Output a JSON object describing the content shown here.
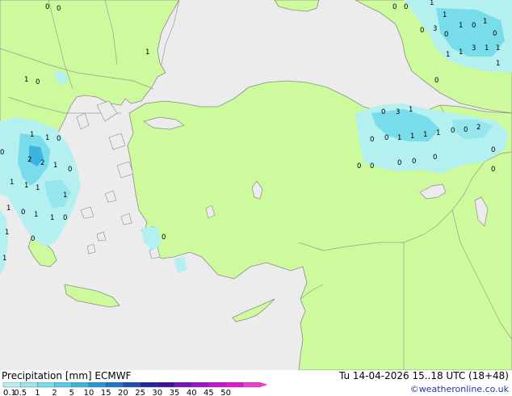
{
  "title": {
    "left": "Precipitation [mm]  ECMWF",
    "right": "Tu 14-04-2026 15..18 UTC (18+48)"
  },
  "credit": "©weatheronline.co.uk",
  "colors": {
    "sea": "#ececec",
    "land": "#ccfa9c",
    "border": "#9a9a9a"
  },
  "legend": {
    "ticks": [
      "0.1",
      "0.5",
      "1",
      "2",
      "5",
      "10",
      "15",
      "20",
      "25",
      "30",
      "35",
      "40",
      "45",
      "50"
    ],
    "colors": [
      "#b4f0f0",
      "#96e6ee",
      "#78dcea",
      "#5ac8e6",
      "#3cb4e0",
      "#2896d6",
      "#1e78c8",
      "#1e50b4",
      "#1e28a0",
      "#3c1496",
      "#7814b4",
      "#a014c8",
      "#c814d2",
      "#e614c8",
      "#f03cd2"
    ]
  },
  "precip_labels": [
    {
      "name": "label-nw-1",
      "text": "0"
    },
    {
      "name": "label-nw-2",
      "text": "0"
    },
    {
      "name": "label-nw-3",
      "text": "1"
    },
    {
      "name": "label-bal-1",
      "text": "1"
    },
    {
      "name": "label-bal-2",
      "text": "0"
    },
    {
      "name": "label-gr-1",
      "text": "1"
    },
    {
      "name": "label-gr-2",
      "text": "1"
    },
    {
      "name": "label-gr-3",
      "text": "0"
    },
    {
      "name": "label-gr-4",
      "text": "2"
    },
    {
      "name": "label-gr-5",
      "text": "2"
    },
    {
      "name": "label-gr-6",
      "text": "1"
    },
    {
      "name": "label-gr-7",
      "text": "0"
    },
    {
      "name": "label-gr-8",
      "text": "1"
    },
    {
      "name": "label-gr-9",
      "text": "1"
    },
    {
      "name": "label-gr-10",
      "text": "1"
    },
    {
      "name": "label-gr-11",
      "text": "1"
    },
    {
      "name": "label-gr-12",
      "text": "1"
    },
    {
      "name": "label-gr-13",
      "text": "0"
    },
    {
      "name": "label-gr-14",
      "text": "1"
    },
    {
      "name": "label-gr-15",
      "text": "0"
    },
    {
      "name": "label-gr-16",
      "text": "1"
    },
    {
      "name": "label-gr-17",
      "text": "0"
    },
    {
      "name": "label-gr-18",
      "text": "1"
    },
    {
      "name": "label-gr-19",
      "text": "1"
    },
    {
      "name": "label-gr-20",
      "text": "0"
    },
    {
      "name": "label-aeg-1",
      "text": "0"
    },
    {
      "name": "label-ne-1",
      "text": "0"
    },
    {
      "name": "label-ne-2",
      "text": "0"
    },
    {
      "name": "label-ne-3",
      "text": "1"
    },
    {
      "name": "label-ne-4",
      "text": "1"
    },
    {
      "name": "label-ne-5",
      "text": "0"
    },
    {
      "name": "label-ne-6",
      "text": "3"
    },
    {
      "name": "label-ne-7",
      "text": "0"
    },
    {
      "name": "label-ne-8",
      "text": "1"
    },
    {
      "name": "label-ne-9",
      "text": "0"
    },
    {
      "name": "label-ne-10",
      "text": "1"
    },
    {
      "name": "label-ne-11",
      "text": "1"
    },
    {
      "name": "label-ne-12",
      "text": "1"
    },
    {
      "name": "label-ne-13",
      "text": "3"
    },
    {
      "name": "label-ne-14",
      "text": "1"
    },
    {
      "name": "label-ne-15",
      "text": "1"
    },
    {
      "name": "label-ne-16",
      "text": "1"
    },
    {
      "name": "label-ne-17",
      "text": "0"
    },
    {
      "name": "label-ne-18",
      "text": "0"
    },
    {
      "name": "label-ct-1",
      "text": "0"
    },
    {
      "name": "label-ct-2",
      "text": "0"
    },
    {
      "name": "label-ct-3",
      "text": "0"
    },
    {
      "name": "label-ct-4",
      "text": "0"
    },
    {
      "name": "label-ct-5",
      "text": "3"
    },
    {
      "name": "label-ct-6",
      "text": "1"
    },
    {
      "name": "label-ct-7",
      "text": "0"
    },
    {
      "name": "label-ct-8",
      "text": "1"
    },
    {
      "name": "label-ct-9",
      "text": "1"
    },
    {
      "name": "label-ct-10",
      "text": "1"
    },
    {
      "name": "label-ct-11",
      "text": "1"
    },
    {
      "name": "label-ct-12",
      "text": "0"
    },
    {
      "name": "label-ct-13",
      "text": "0"
    },
    {
      "name": "label-ct-14",
      "text": "2"
    },
    {
      "name": "label-ct-15",
      "text": "0"
    },
    {
      "name": "label-ct-16",
      "text": "0"
    },
    {
      "name": "label-ct-17",
      "text": "0"
    },
    {
      "name": "label-ct-18",
      "text": "0"
    },
    {
      "name": "label-ct-19",
      "text": "0"
    }
  ]
}
